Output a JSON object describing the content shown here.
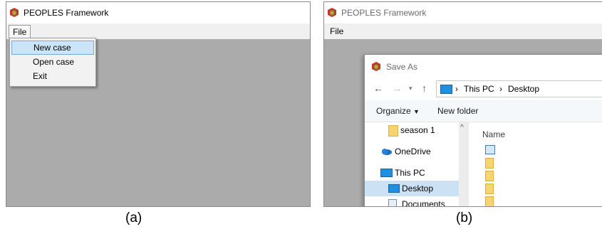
{
  "panel_a": {
    "caption": "(a)",
    "window_title": "PEOPLES Framework",
    "menu": {
      "file_label": "File"
    },
    "file_menu_items": [
      {
        "label": "New case",
        "highlighted": true
      },
      {
        "label": "Open case",
        "highlighted": false
      },
      {
        "label": "Exit",
        "highlighted": false
      }
    ]
  },
  "panel_b": {
    "caption": "(b)",
    "window_title": "PEOPLES Framework",
    "menu": {
      "file_label": "File"
    },
    "dialog": {
      "title": "Save As",
      "address": {
        "root": "This PC",
        "current": "Desktop"
      },
      "commands": {
        "organize": "Organize",
        "new_folder": "New folder"
      },
      "tree": [
        {
          "label": "season 1",
          "icon": "folder-icon",
          "selected": false
        },
        {
          "label": "OneDrive",
          "icon": "cloud-icon",
          "selected": false
        },
        {
          "label": "This PC",
          "icon": "computer-icon",
          "selected": false
        },
        {
          "label": "Desktop",
          "icon": "desktop-icon",
          "selected": true
        },
        {
          "label": "Documents",
          "icon": "documents-icon",
          "selected": false
        }
      ],
      "column_header": "Name"
    }
  },
  "colors": {
    "workspace_gray": "#ababab",
    "menu_highlight": "#cde4f7",
    "tree_selection": "#cce1f4",
    "folder_yellow": "#f5d36f"
  }
}
